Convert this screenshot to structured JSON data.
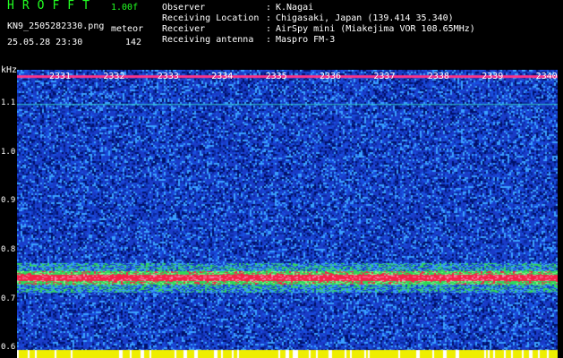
{
  "header": {
    "app_title": "HROFFT",
    "version": "1.00f",
    "filename": "KN9_2505282330.png",
    "datetime": "25.05.28 23:30",
    "meteor_label": "meteor",
    "meteor_count": "142"
  },
  "info": [
    {
      "key": "Observer",
      "value": "K.Nagai"
    },
    {
      "key": "Receiving Location",
      "value": "Chigasaki, Japan (139.414 35.340)"
    },
    {
      "key": "Receiver",
      "value": "AirSpy mini (Miakejima VOR 108.65MHz)"
    },
    {
      "key": "Receiving antenna",
      "value": "Maspro FM-3"
    }
  ],
  "separator": ":",
  "chart_data": {
    "type": "heatmap",
    "ylabel": "kHz",
    "y_ticks": [
      "1.1",
      "1.0",
      "0.9",
      "0.8",
      "0.7",
      "0.6"
    ],
    "time_ticks": [
      "2331",
      "2332",
      "2333",
      "2334",
      "2335",
      "2336",
      "2337",
      "2338",
      "2339",
      "2340"
    ],
    "ylim": [
      0.58,
      1.17
    ],
    "signal_band_khz": 0.745,
    "top_band_khz": 1.157,
    "guide_line_khz": 1.1,
    "colors": {
      "background": "#000000",
      "noise_low": "#00106a",
      "noise_mid": "#1a3cc8",
      "noise_high": "#3aa0ff",
      "band_green": "#33dd55",
      "band_red": "#ff2244",
      "top_line": "#ff3388",
      "guide_line": "#33cccc",
      "bottom_strip": "#eeee00",
      "title_green": "#22ff22"
    }
  }
}
